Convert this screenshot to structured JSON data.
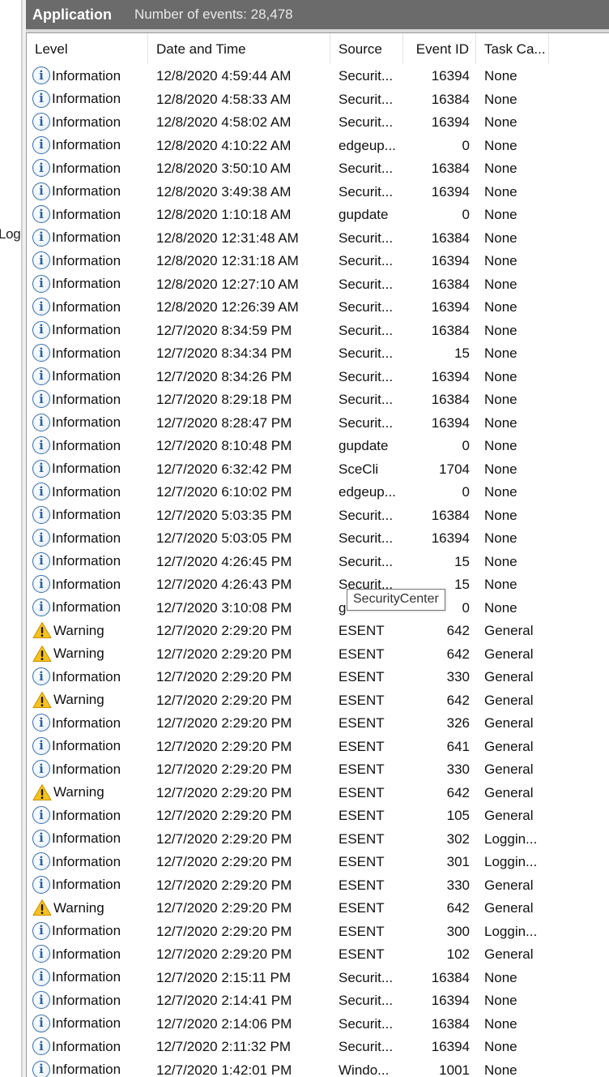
{
  "left_pane": {
    "fragment": "Log"
  },
  "header": {
    "title": "Application",
    "event_count": "Number of events: 28,478"
  },
  "columns": [
    "Level",
    "Date and Time",
    "Source",
    "Event ID",
    "Task Ca..."
  ],
  "icons": {
    "info": "information-icon",
    "warning": "warning-icon"
  },
  "rows": [
    {
      "level": "Information",
      "date": "12/8/2020 4:59:44 AM",
      "source": "Securit...",
      "event_id": "16394",
      "task": "None"
    },
    {
      "level": "Information",
      "date": "12/8/2020 4:58:33 AM",
      "source": "Securit...",
      "event_id": "16384",
      "task": "None"
    },
    {
      "level": "Information",
      "date": "12/8/2020 4:58:02 AM",
      "source": "Securit...",
      "event_id": "16394",
      "task": "None"
    },
    {
      "level": "Information",
      "date": "12/8/2020 4:10:22 AM",
      "source": "edgeup...",
      "event_id": "0",
      "task": "None"
    },
    {
      "level": "Information",
      "date": "12/8/2020 3:50:10 AM",
      "source": "Securit...",
      "event_id": "16384",
      "task": "None"
    },
    {
      "level": "Information",
      "date": "12/8/2020 3:49:38 AM",
      "source": "Securit...",
      "event_id": "16394",
      "task": "None"
    },
    {
      "level": "Information",
      "date": "12/8/2020 1:10:18 AM",
      "source": "gupdate",
      "event_id": "0",
      "task": "None"
    },
    {
      "level": "Information",
      "date": "12/8/2020 12:31:48 AM",
      "source": "Securit...",
      "event_id": "16384",
      "task": "None"
    },
    {
      "level": "Information",
      "date": "12/8/2020 12:31:18 AM",
      "source": "Securit...",
      "event_id": "16394",
      "task": "None"
    },
    {
      "level": "Information",
      "date": "12/8/2020 12:27:10 AM",
      "source": "Securit...",
      "event_id": "16384",
      "task": "None"
    },
    {
      "level": "Information",
      "date": "12/8/2020 12:26:39 AM",
      "source": "Securit...",
      "event_id": "16394",
      "task": "None"
    },
    {
      "level": "Information",
      "date": "12/7/2020 8:34:59 PM",
      "source": "Securit...",
      "event_id": "16384",
      "task": "None"
    },
    {
      "level": "Information",
      "date": "12/7/2020 8:34:34 PM",
      "source": "Securit...",
      "event_id": "15",
      "task": "None"
    },
    {
      "level": "Information",
      "date": "12/7/2020 8:34:26 PM",
      "source": "Securit...",
      "event_id": "16394",
      "task": "None"
    },
    {
      "level": "Information",
      "date": "12/7/2020 8:29:18 PM",
      "source": "Securit...",
      "event_id": "16384",
      "task": "None"
    },
    {
      "level": "Information",
      "date": "12/7/2020 8:28:47 PM",
      "source": "Securit...",
      "event_id": "16394",
      "task": "None"
    },
    {
      "level": "Information",
      "date": "12/7/2020 8:10:48 PM",
      "source": "gupdate",
      "event_id": "0",
      "task": "None"
    },
    {
      "level": "Information",
      "date": "12/7/2020 6:32:42 PM",
      "source": "SceCli",
      "event_id": "1704",
      "task": "None"
    },
    {
      "level": "Information",
      "date": "12/7/2020 6:10:02 PM",
      "source": "edgeup...",
      "event_id": "0",
      "task": "None"
    },
    {
      "level": "Information",
      "date": "12/7/2020 5:03:35 PM",
      "source": "Securit...",
      "event_id": "16384",
      "task": "None"
    },
    {
      "level": "Information",
      "date": "12/7/2020 5:03:05 PM",
      "source": "Securit...",
      "event_id": "16394",
      "task": "None"
    },
    {
      "level": "Information",
      "date": "12/7/2020 4:26:45 PM",
      "source": "Securit...",
      "event_id": "15",
      "task": "None"
    },
    {
      "level": "Information",
      "date": "12/7/2020 4:26:43 PM",
      "source": "Securit...",
      "event_id": "15",
      "task": "None"
    },
    {
      "level": "Information",
      "date": "12/7/2020 3:10:08 PM",
      "source": "g",
      "event_id": "0",
      "task": "None"
    },
    {
      "level": "Warning",
      "date": "12/7/2020 2:29:20 PM",
      "source": "ESENT",
      "event_id": "642",
      "task": "General"
    },
    {
      "level": "Warning",
      "date": "12/7/2020 2:29:20 PM",
      "source": "ESENT",
      "event_id": "642",
      "task": "General"
    },
    {
      "level": "Information",
      "date": "12/7/2020 2:29:20 PM",
      "source": "ESENT",
      "event_id": "330",
      "task": "General"
    },
    {
      "level": "Warning",
      "date": "12/7/2020 2:29:20 PM",
      "source": "ESENT",
      "event_id": "642",
      "task": "General"
    },
    {
      "level": "Information",
      "date": "12/7/2020 2:29:20 PM",
      "source": "ESENT",
      "event_id": "326",
      "task": "General"
    },
    {
      "level": "Information",
      "date": "12/7/2020 2:29:20 PM",
      "source": "ESENT",
      "event_id": "641",
      "task": "General"
    },
    {
      "level": "Information",
      "date": "12/7/2020 2:29:20 PM",
      "source": "ESENT",
      "event_id": "330",
      "task": "General"
    },
    {
      "level": "Warning",
      "date": "12/7/2020 2:29:20 PM",
      "source": "ESENT",
      "event_id": "642",
      "task": "General"
    },
    {
      "level": "Information",
      "date": "12/7/2020 2:29:20 PM",
      "source": "ESENT",
      "event_id": "105",
      "task": "General"
    },
    {
      "level": "Information",
      "date": "12/7/2020 2:29:20 PM",
      "source": "ESENT",
      "event_id": "302",
      "task": "Loggin..."
    },
    {
      "level": "Information",
      "date": "12/7/2020 2:29:20 PM",
      "source": "ESENT",
      "event_id": "301",
      "task": "Loggin..."
    },
    {
      "level": "Information",
      "date": "12/7/2020 2:29:20 PM",
      "source": "ESENT",
      "event_id": "330",
      "task": "General"
    },
    {
      "level": "Warning",
      "date": "12/7/2020 2:29:20 PM",
      "source": "ESENT",
      "event_id": "642",
      "task": "General"
    },
    {
      "level": "Information",
      "date": "12/7/2020 2:29:20 PM",
      "source": "ESENT",
      "event_id": "300",
      "task": "Loggin..."
    },
    {
      "level": "Information",
      "date": "12/7/2020 2:29:20 PM",
      "source": "ESENT",
      "event_id": "102",
      "task": "General"
    },
    {
      "level": "Information",
      "date": "12/7/2020 2:15:11 PM",
      "source": "Securit...",
      "event_id": "16384",
      "task": "None"
    },
    {
      "level": "Information",
      "date": "12/7/2020 2:14:41 PM",
      "source": "Securit...",
      "event_id": "16394",
      "task": "None"
    },
    {
      "level": "Information",
      "date": "12/7/2020 2:14:06 PM",
      "source": "Securit...",
      "event_id": "16384",
      "task": "None"
    },
    {
      "level": "Information",
      "date": "12/7/2020 2:11:32 PM",
      "source": "Securit...",
      "event_id": "16394",
      "task": "None"
    },
    {
      "level": "Information",
      "date": "12/7/2020 1:42:01 PM",
      "source": "Windo...",
      "event_id": "1001",
      "task": "None"
    }
  ],
  "tooltip": {
    "text": "SecurityCenter"
  }
}
